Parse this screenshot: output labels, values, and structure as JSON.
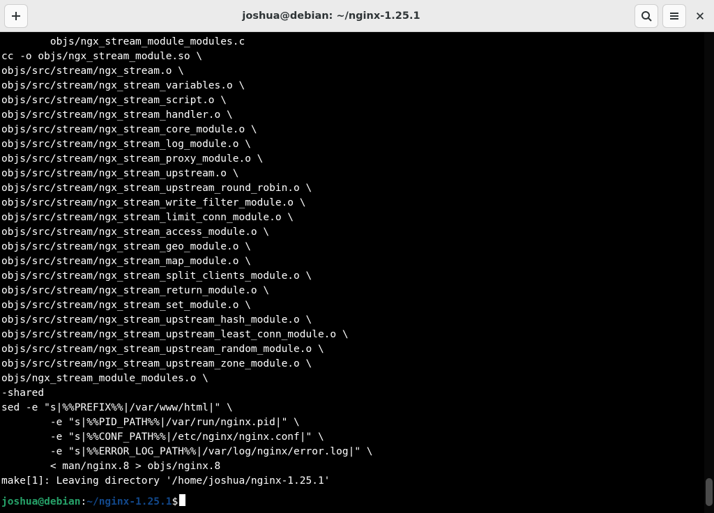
{
  "titlebar": {
    "title": "joshua@debian: ~/nginx-1.25.1"
  },
  "prompt": {
    "user_host": "joshua@debian",
    "colon": ":",
    "path": "~/nginx-1.25.1",
    "dollar": "$"
  },
  "terminal_output": "        objs/ngx_stream_module_modules.c\ncc -o objs/ngx_stream_module.so \\\nobjs/src/stream/ngx_stream.o \\\nobjs/src/stream/ngx_stream_variables.o \\\nobjs/src/stream/ngx_stream_script.o \\\nobjs/src/stream/ngx_stream_handler.o \\\nobjs/src/stream/ngx_stream_core_module.o \\\nobjs/src/stream/ngx_stream_log_module.o \\\nobjs/src/stream/ngx_stream_proxy_module.o \\\nobjs/src/stream/ngx_stream_upstream.o \\\nobjs/src/stream/ngx_stream_upstream_round_robin.o \\\nobjs/src/stream/ngx_stream_write_filter_module.o \\\nobjs/src/stream/ngx_stream_limit_conn_module.o \\\nobjs/src/stream/ngx_stream_access_module.o \\\nobjs/src/stream/ngx_stream_geo_module.o \\\nobjs/src/stream/ngx_stream_map_module.o \\\nobjs/src/stream/ngx_stream_split_clients_module.o \\\nobjs/src/stream/ngx_stream_return_module.o \\\nobjs/src/stream/ngx_stream_set_module.o \\\nobjs/src/stream/ngx_stream_upstream_hash_module.o \\\nobjs/src/stream/ngx_stream_upstream_least_conn_module.o \\\nobjs/src/stream/ngx_stream_upstream_random_module.o \\\nobjs/src/stream/ngx_stream_upstream_zone_module.o \\\nobjs/ngx_stream_module_modules.o \\\n-shared\nsed -e \"s|%%PREFIX%%|/var/www/html|\" \\\n        -e \"s|%%PID_PATH%%|/var/run/nginx.pid|\" \\\n        -e \"s|%%CONF_PATH%%|/etc/nginx/nginx.conf|\" \\\n        -e \"s|%%ERROR_LOG_PATH%%|/var/log/nginx/error.log|\" \\\n        < man/nginx.8 > objs/nginx.8\nmake[1]: Leaving directory '/home/joshua/nginx-1.25.1'"
}
